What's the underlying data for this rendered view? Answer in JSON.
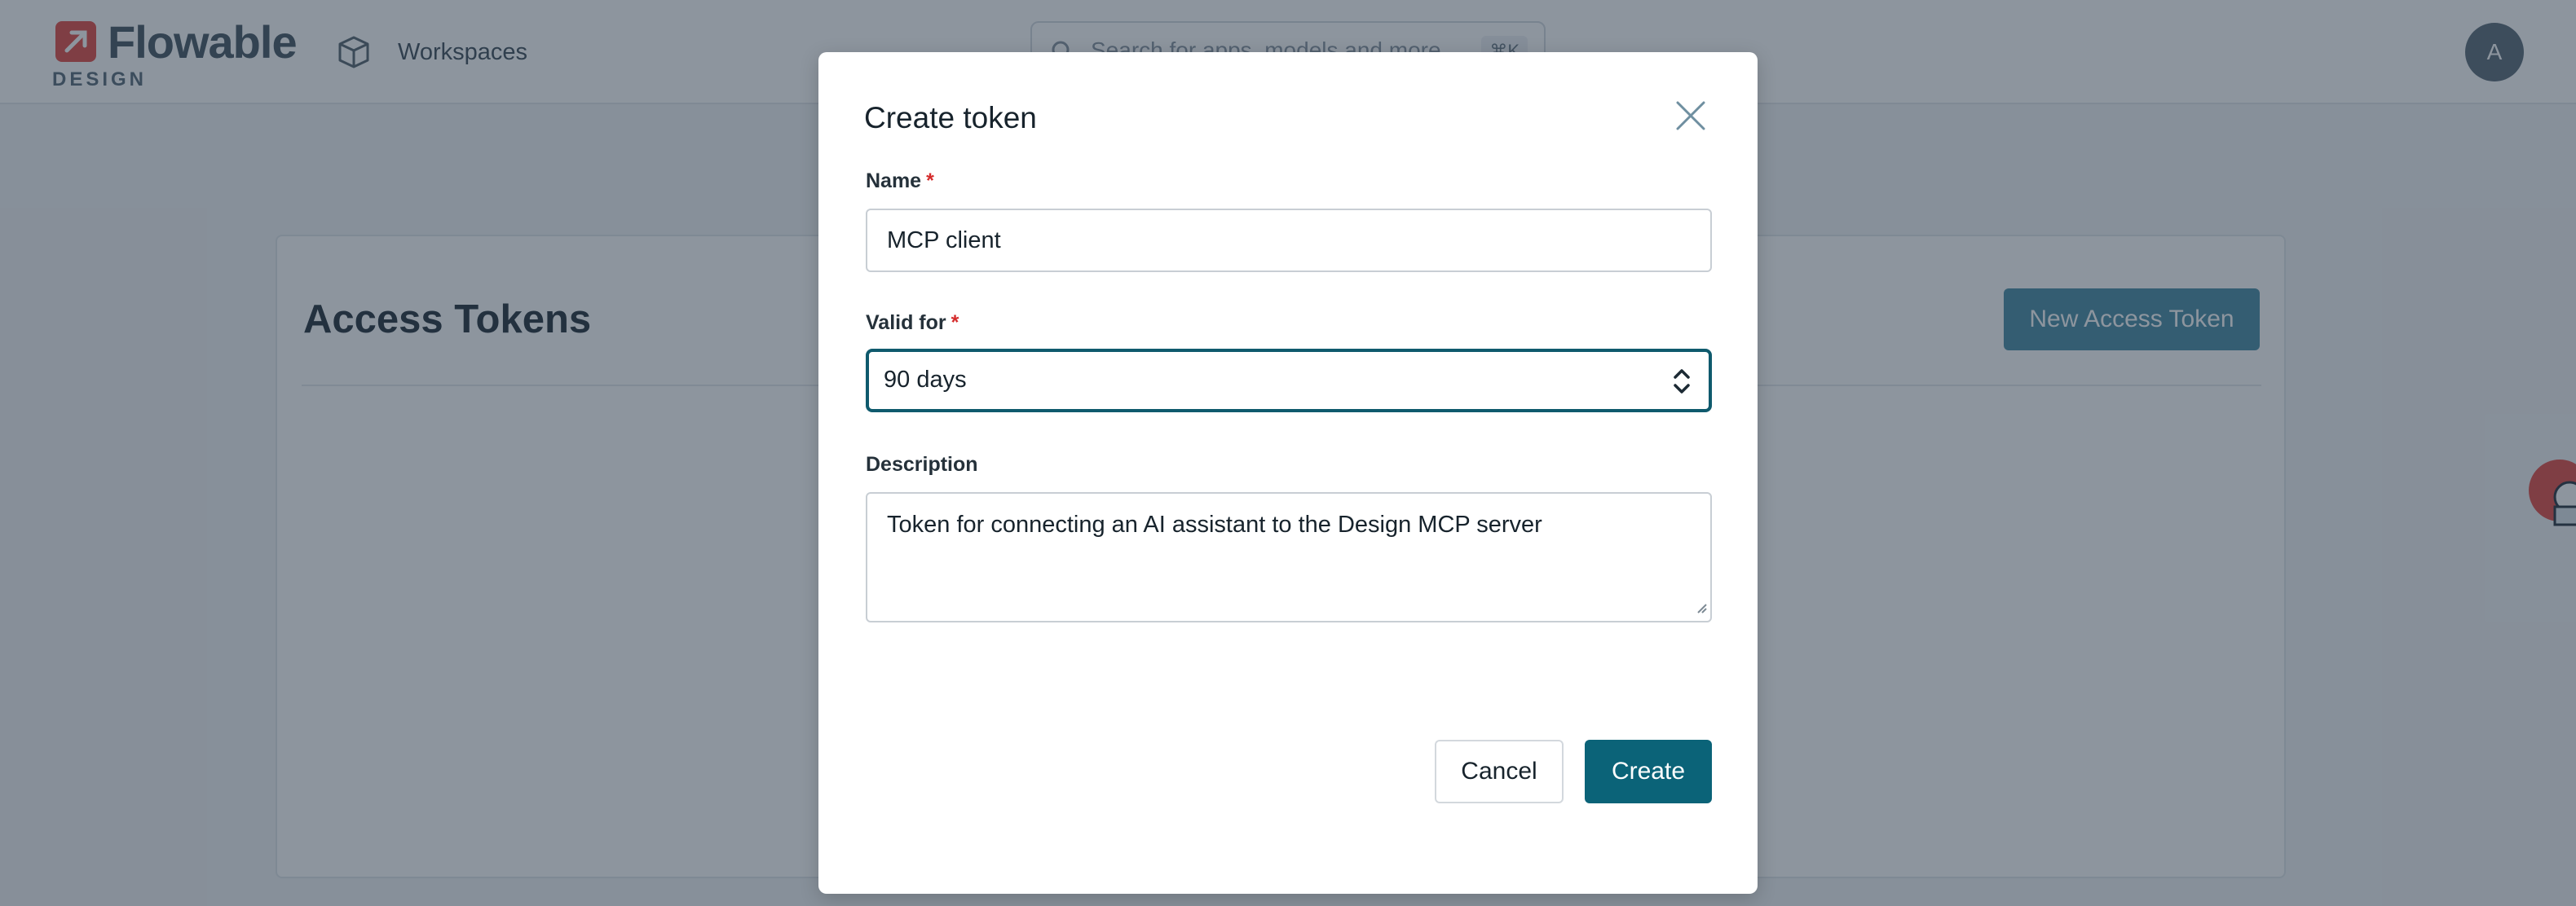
{
  "app": {
    "logo_word": "Flowable",
    "logo_sub": "DESIGN",
    "nav_workspaces": "Workspaces",
    "search_placeholder": "Search for apps, models and more",
    "search_shortcut": "⌘K",
    "avatar_initial": "A"
  },
  "page": {
    "title": "Access Tokens",
    "new_token_label": "New Access Token"
  },
  "modal": {
    "title": "Create token",
    "name_label": "Name",
    "name_value": "MCP client",
    "required_marker": "*",
    "valid_for_label": "Valid for",
    "valid_for_value": "90 days",
    "description_label": "Description",
    "description_value": "Token for connecting an AI assistant to the Design MCP server",
    "cancel_label": "Cancel",
    "create_label": "Create"
  },
  "icons": {
    "logo": "flowable-logo-icon",
    "workspaces": "cube-icon",
    "search": "search-icon",
    "close": "close-icon",
    "select": "chevron-up-down-icon"
  },
  "colors": {
    "primary": "#0b6378",
    "focus_border": "#0f5a6d",
    "required": "#d52b2b",
    "logo": "#e3514a"
  }
}
